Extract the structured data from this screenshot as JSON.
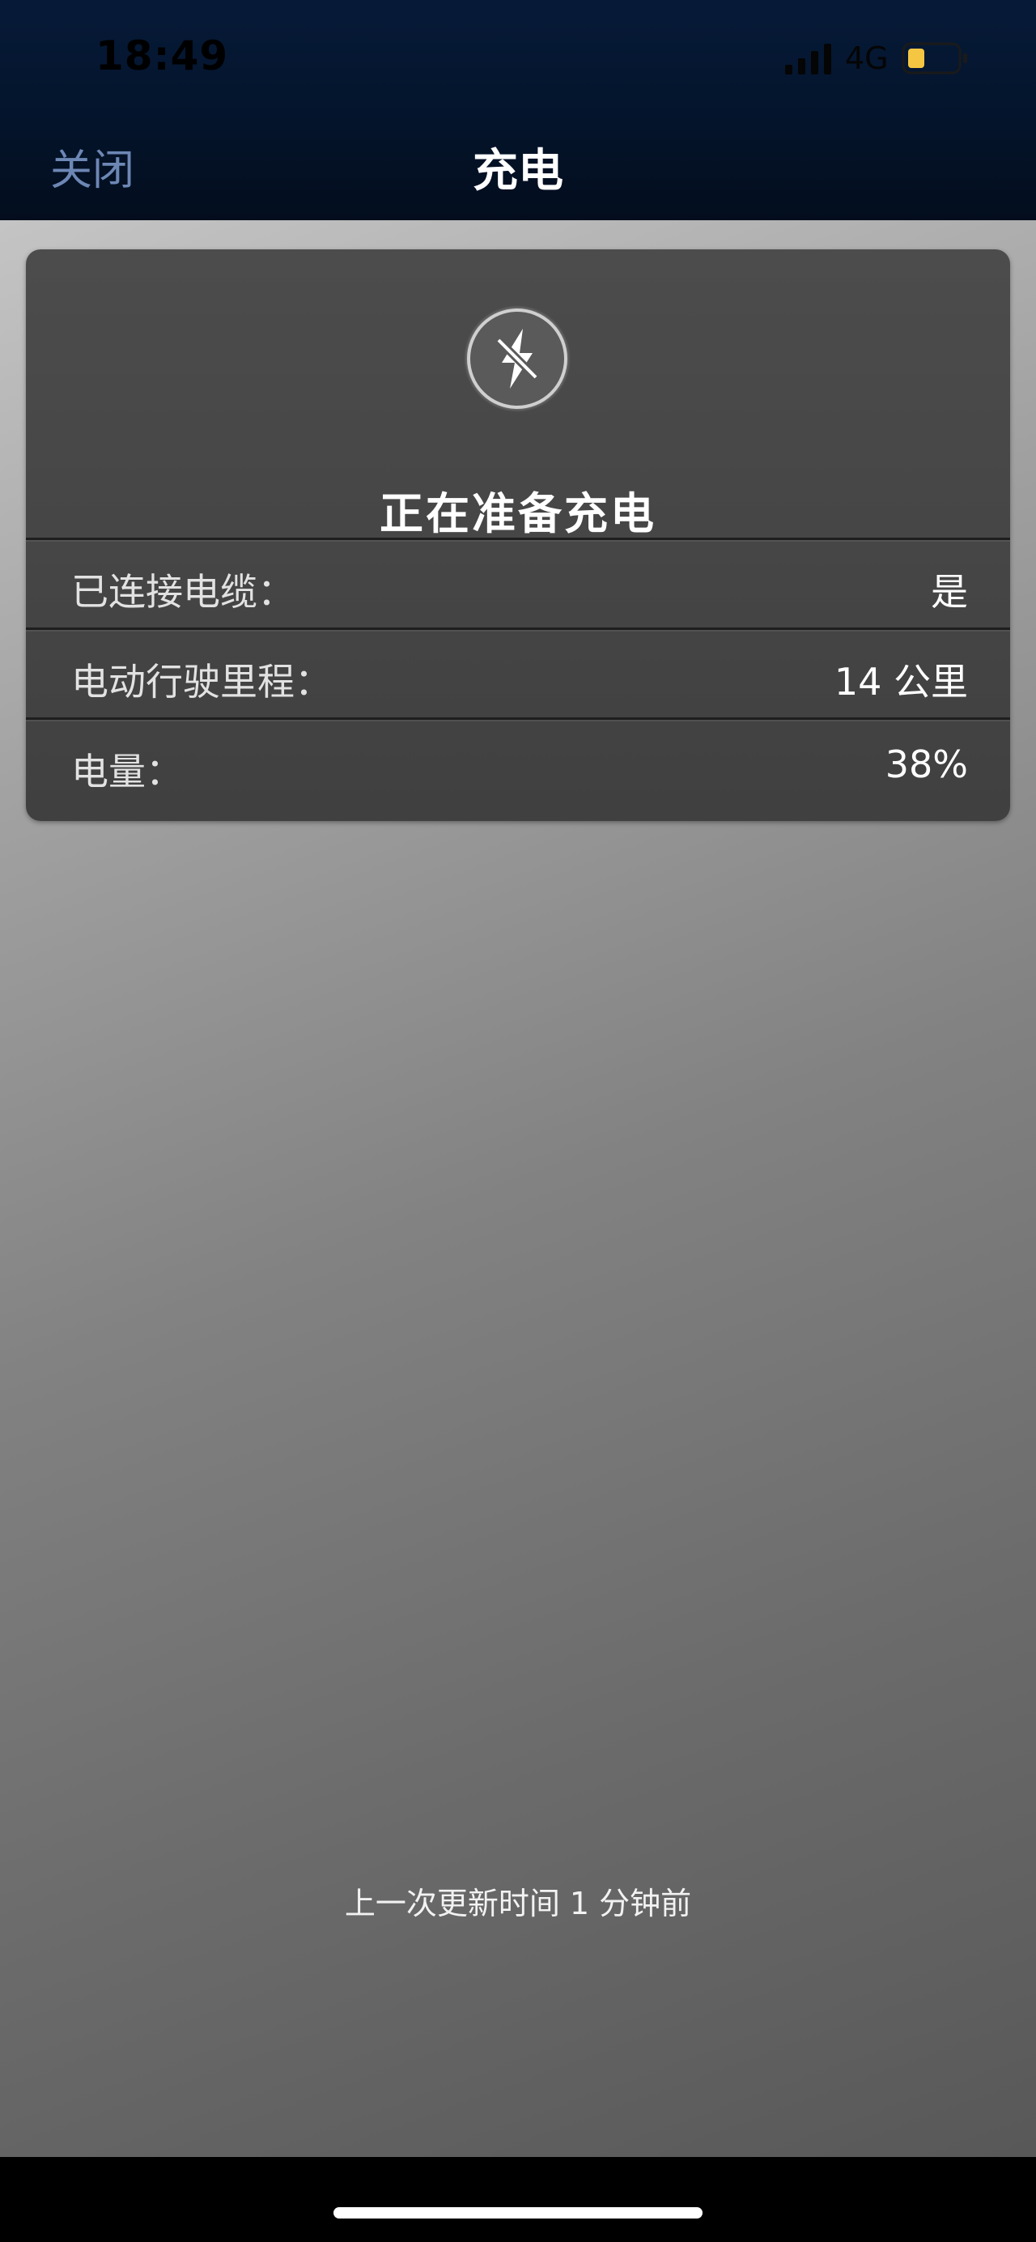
{
  "status_bar": {
    "time": "18:49",
    "network": "4G",
    "icons": [
      "signal-icon",
      "battery-icon"
    ],
    "battery_color": "#f5c642"
  },
  "nav": {
    "close_label": "关闭",
    "title": "充电"
  },
  "charging_card": {
    "icon": "charging-bolt-icon",
    "status_title": "正在准备充电",
    "rows": [
      {
        "label": "已连接电缆：",
        "value": "是"
      },
      {
        "label": "电动行驶里程：",
        "value": "14 公里"
      },
      {
        "label": "电量：",
        "value": "38%"
      }
    ]
  },
  "footer": {
    "update_text": "上一次更新时间 1 分钟前"
  },
  "colors": {
    "nav_background": "#04142b",
    "close_link": "#6d87b5",
    "card_background": "#444444"
  }
}
